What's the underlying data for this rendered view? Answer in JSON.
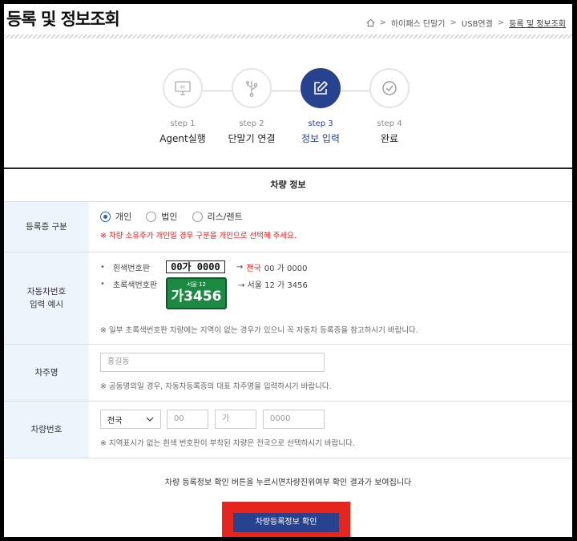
{
  "page": {
    "title": "등록 및 정보조회"
  },
  "breadcrumb": {
    "items": [
      "하이패스 단말기",
      "USB연결",
      "등록 및 정보조회"
    ]
  },
  "steps": [
    {
      "num": "step 1",
      "label": "Agent실행",
      "icon": "monitor-4k-icon",
      "active": false
    },
    {
      "num": "step 2",
      "label": "단말기 연결",
      "icon": "usb-icon",
      "active": false
    },
    {
      "num": "step 3",
      "label": "정보 입력",
      "icon": "edit-icon",
      "active": true
    },
    {
      "num": "step 4",
      "label": "완료",
      "icon": "check-circle-icon",
      "active": false
    }
  ],
  "form": {
    "section_title": "차량 정보",
    "reg_type": {
      "label": "등록증 구분",
      "options": [
        "개인",
        "법인",
        "리스/렌트"
      ],
      "selected": "개인",
      "note": "※ 차량 소유주가 개인일 경우 구분을 개인으로 선택해 주세요."
    },
    "example": {
      "label_line1": "자동차번호",
      "label_line2": "입력 예시",
      "white_label": "흰색번호판",
      "white_plate": "00가 0000",
      "white_result_arrow": "→",
      "white_result_region": "전국",
      "white_result_rest": "00 가 0000",
      "green_label": "초록색번호판",
      "green_plate_top": "서울 12",
      "green_plate_bottom": "가3456",
      "green_result": "→ 서울 12 가 3456",
      "note": "※ 일부 초록색번호판 차량에는 지역이 없는 경우가 있으니 꼭 자동차 등록증을 참고하시기 바랍니다."
    },
    "owner": {
      "label": "차주명",
      "placeholder": "홍길동",
      "note": "※ 공동명의일 경우, 자동차등록증의 대표 차주명을 입력하시기 바랍니다."
    },
    "plate": {
      "label": "차량번호",
      "region_selected": "전국",
      "num1_placeholder": "00",
      "char_placeholder": "가",
      "num2_placeholder": "0000",
      "note": "※ 지역표시가 없는 흰색 번호판이 부착된 차량은 전국으로 선택하시기 바랍니다."
    }
  },
  "bottom_message": "차량 등록정보 확인 버튼을 누르시면차량진위여부 확인 결과가 보여집니다",
  "confirm_label": "차량등록정보 확인",
  "colors": {
    "primary": "#27428f",
    "highlight": "#e5261f",
    "note_red": "#e02020",
    "label_bg": "#eef4fb"
  }
}
